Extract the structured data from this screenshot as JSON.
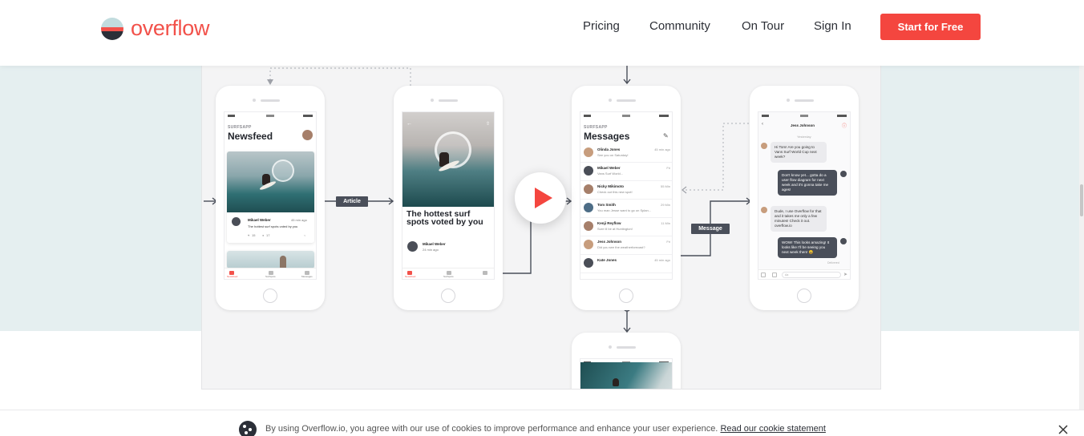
{
  "header": {
    "logo_text": "overflow",
    "nav": [
      "Pricing",
      "Community",
      "On Tour",
      "Sign In"
    ],
    "cta_label": "Start for Free"
  },
  "colors": {
    "brand": "#f4463f",
    "dark": "#2b2f38",
    "band": "#e5eff0"
  },
  "flow": {
    "labels": {
      "article": "Article",
      "message": "Message"
    }
  },
  "newsfeed": {
    "app_label": "SURFSAPP",
    "title": "Newsfeed",
    "post_author": "Mikael Weber",
    "post_time": "45 min ago",
    "post_text": "The hottest surf spots voted by you",
    "likes": "15",
    "comments": "17",
    "tabs": [
      "Newsfeed",
      "Surfspots",
      "Messages"
    ]
  },
  "article": {
    "headline": "The hottest surf spots voted by you",
    "author": "Mikael Weber",
    "time": "24 min ago",
    "tabs": [
      "Newsfeed",
      "Surfspots",
      "Messages"
    ]
  },
  "messages": {
    "app_label": "SURFSAPP",
    "title": "Messages",
    "rows": [
      {
        "name": "Olinda Jones",
        "preview": "See you on Saturday!",
        "time": "45 min ago"
      },
      {
        "name": "Mikael Weber",
        "preview": "Vans Surf World...",
        "time": "Fri"
      },
      {
        "name": "Nicky Mikimoto",
        "preview": "Check out this new spot!",
        "time": "55 Min"
      },
      {
        "name": "Tom Smith",
        "preview": "You man Jesse want to go on Splan...",
        "time": "29 Min"
      },
      {
        "name": "Kenji Reyflow",
        "preview": "Sure ill be at Huntington!",
        "time": "11 Min"
      },
      {
        "name": "Jess Johnson",
        "preview": "Did you see the weatherforecast?",
        "time": "Fri"
      },
      {
        "name": "Kate Jones",
        "preview": "",
        "time": "45 min ago"
      }
    ]
  },
  "chat": {
    "contact": "Jess Johnson",
    "date": "Yesterday",
    "bubbles": [
      {
        "dir": "in",
        "text": "Hi Tom! Are you going to Vans Surf World Cup next week?"
      },
      {
        "dir": "out",
        "text": "Don't know yet... gotta do a user flow diagram for next week and it's gonna take me ages!"
      },
      {
        "dir": "in",
        "text": "Dude, I use Overflow for that and it takes me only a few minutes! Check it out. overflow.io"
      },
      {
        "dir": "out",
        "text": "WOW! This looks amazing! It looks like I'll be seeing you next week then! 😀"
      }
    ],
    "read": "Delivered",
    "input_placeholder": "Aa"
  },
  "cookie": {
    "text": "By using Overflow.io, you agree with our use of cookies to improve performance and enhance your user experience.",
    "link": "Read our cookie statement"
  }
}
